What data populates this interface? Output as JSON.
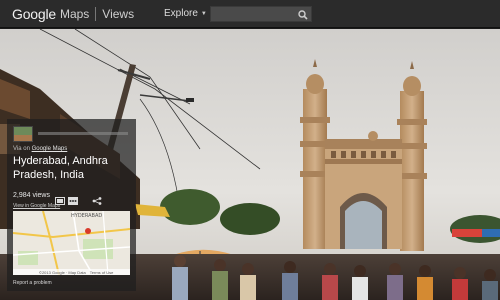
{
  "topbar": {
    "logo_google": "Google",
    "logo_maps": "Maps",
    "logo_views": "Views",
    "explore_label": "Explore",
    "search_value": "",
    "search_placeholder": ""
  },
  "panel": {
    "via_prefix": "Via on",
    "via_link": "Google Maps",
    "title": "Hyderabad, Andhra Pradesh, India",
    "views_count": "2,984 views",
    "pano_link": "View in Google Maps",
    "map": {
      "label_city": "HYDERABAD",
      "copyright": "©2013 Google · Map Data",
      "terms": "Terms of Use"
    },
    "report": "Report a problem"
  },
  "colors": {
    "topbar_bg": "#2b2b2b",
    "panel_bg": "rgba(30,30,30,0.72)",
    "sky": "#d9d6d2",
    "monument": "#c8a57a"
  }
}
